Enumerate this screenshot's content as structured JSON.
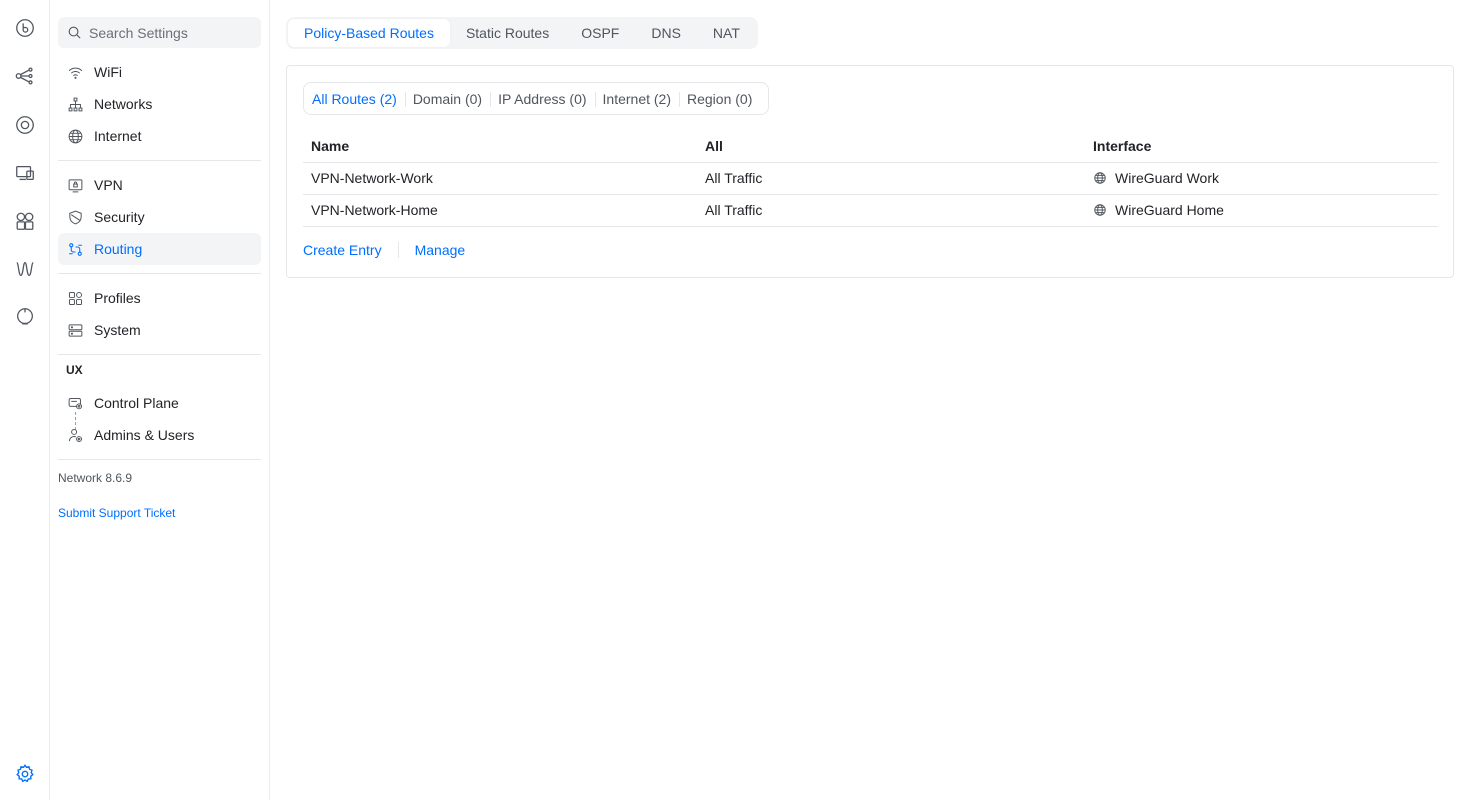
{
  "search": {
    "placeholder": "Search Settings"
  },
  "sidebar": {
    "items": [
      {
        "label": "WiFi",
        "icon": "wifi-icon"
      },
      {
        "label": "Networks",
        "icon": "networks-icon"
      },
      {
        "label": "Internet",
        "icon": "globe-icon"
      },
      {
        "label": "VPN",
        "icon": "vpn-icon"
      },
      {
        "label": "Security",
        "icon": "shield-icon"
      },
      {
        "label": "Routing",
        "icon": "routing-icon",
        "active": true
      },
      {
        "label": "Profiles",
        "icon": "profiles-icon"
      },
      {
        "label": "System",
        "icon": "system-icon"
      },
      {
        "label": "Control Plane",
        "icon": "control-plane-icon"
      },
      {
        "label": "Admins & Users",
        "icon": "admins-icon"
      }
    ],
    "section_ux": "UX",
    "version": "Network 8.6.9",
    "support_link": "Submit Support Ticket"
  },
  "tabs": [
    {
      "label": "Policy-Based Routes",
      "active": true
    },
    {
      "label": "Static Routes"
    },
    {
      "label": "OSPF"
    },
    {
      "label": "DNS"
    },
    {
      "label": "NAT"
    }
  ],
  "filters": [
    {
      "label": "All Routes (2)",
      "active": true
    },
    {
      "label": "Domain (0)"
    },
    {
      "label": "IP Address (0)"
    },
    {
      "label": "Internet (2)"
    },
    {
      "label": "Region (0)"
    }
  ],
  "table": {
    "columns": [
      "Name",
      "All",
      "Interface"
    ],
    "rows": [
      {
        "name": "VPN-Network-Work",
        "traffic": "All Traffic",
        "interface": "WireGuard Work"
      },
      {
        "name": "VPN-Network-Home",
        "traffic": "All Traffic",
        "interface": "WireGuard Home"
      }
    ]
  },
  "actions": {
    "create": "Create Entry",
    "manage": "Manage"
  },
  "colors": {
    "accent": "#006fff",
    "text": "#212327",
    "muted": "#50565e"
  }
}
